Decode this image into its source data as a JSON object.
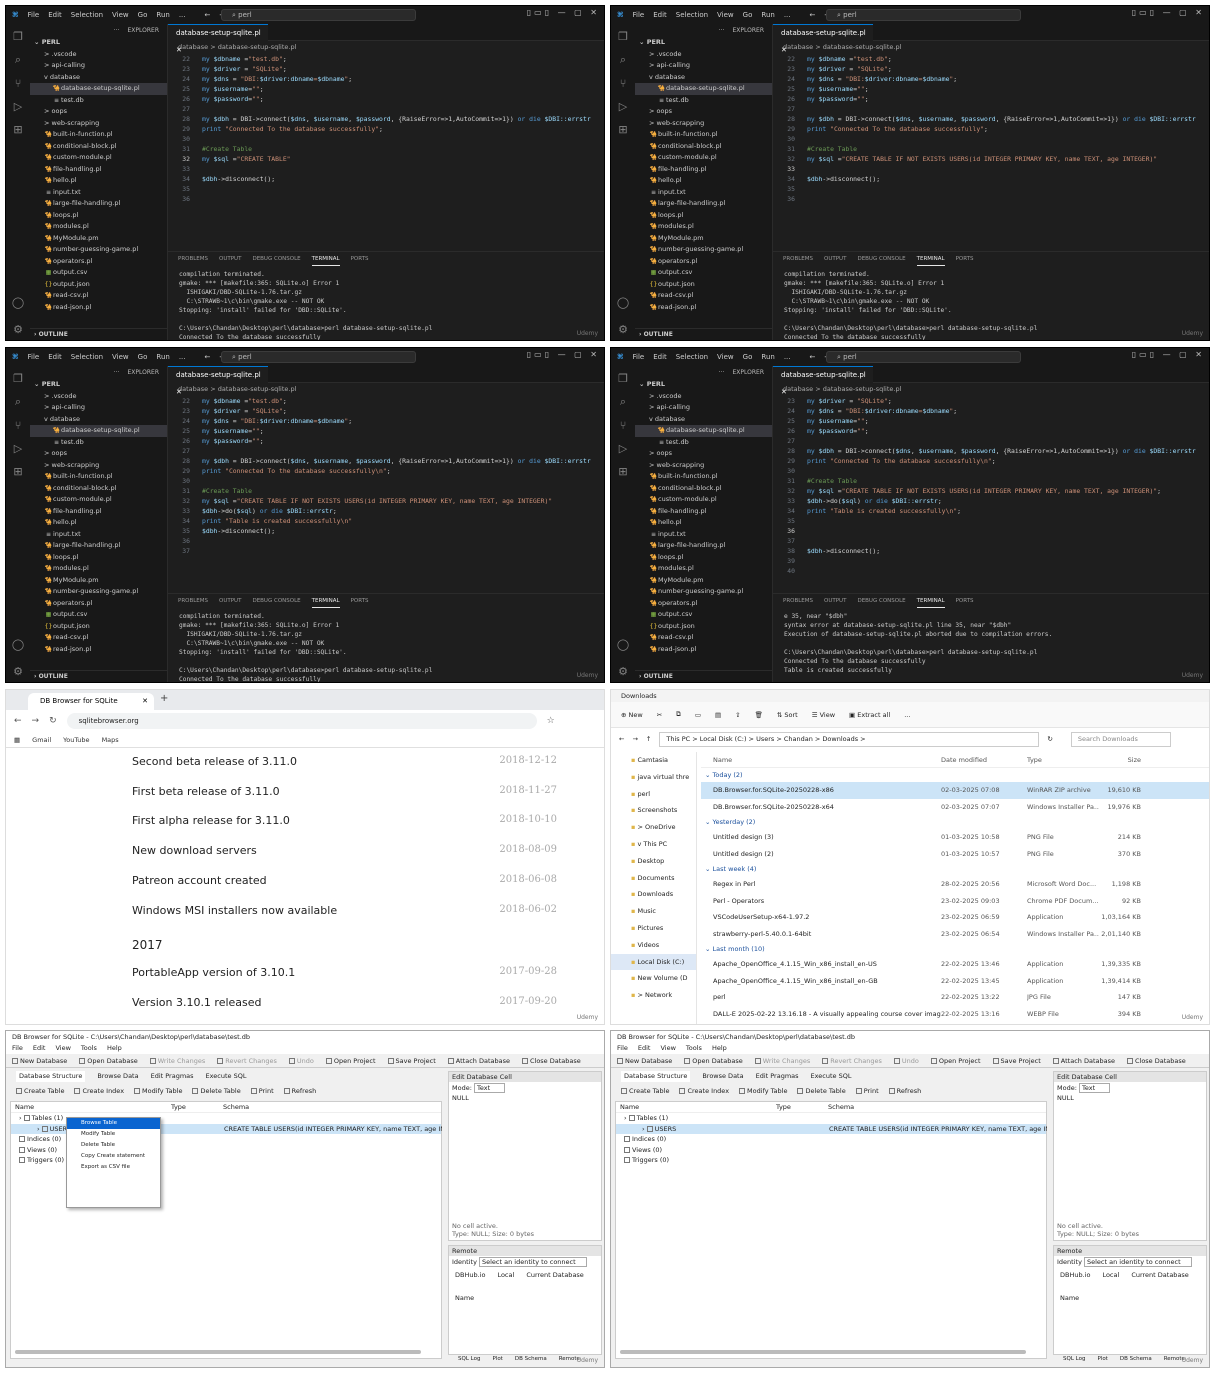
{
  "vscode": {
    "menu": [
      "File",
      "Edit",
      "Selection",
      "View",
      "Go",
      "Run",
      "..."
    ],
    "search": "perl",
    "explorer_title": "EXPLORER",
    "root": "PERL",
    "tab": "database-setup-sqlite.pl",
    "breadcrumb": "database > database-setup-sqlite.pl",
    "term_tabs": [
      "PROBLEMS",
      "OUTPUT",
      "DEBUG CONSOLE",
      "TERMINAL",
      "PORTS"
    ],
    "outline": "OUTLINE",
    "files_a": [
      "> .vscode",
      "> api-calling",
      "v database",
      "database-setup-sqlite.pl",
      "test.db",
      "> oops",
      "> web-scrapping",
      "built-in-function.pl",
      "conditional-block.pl",
      "custom-module.pl",
      "file-handling.pl",
      "hello.pl",
      "input.txt",
      "large-file-handling.pl",
      "loops.pl",
      "modules.pl",
      "MyModule.pm",
      "number-guessing-game.pl",
      "operators.pl",
      "output.csv",
      "output.json",
      "read-csv.pl",
      "read-json.pl"
    ],
    "files_b": [
      "> .vscode",
      "> api-calling",
      "v database",
      "database-setup-sqlite.pl",
      "test.db",
      "> oops",
      "> web-scrapping",
      "built-in-function.pl",
      "conditional-block.pl",
      "custom-module.pl",
      "file-handling.pl",
      "hello.pl",
      "input.txt",
      "large-file-handling.pl",
      "loops.pl",
      "modules.pl",
      "MyModule.pm",
      "number-guessing-game.pl",
      "operators.pl",
      "output.csv",
      "output.json",
      "read-csv.pl",
      "read-json.pl"
    ],
    "files_c": [
      "> .vscode",
      "> api-calling",
      "v database",
      "database-setup-sqlite.pl",
      "test.db",
      "> oops",
      "> web-scrapping",
      "built-in-function.pl",
      "conditional-block.pl",
      "custom-module.pl",
      "file-handling.pl",
      "hello.pl",
      "input.txt",
      "large-file-handling.pl",
      "loops.pl",
      "modules.pl",
      "MyModule.pm",
      "number-guessing-game.pl",
      "operators.pl",
      "output.csv",
      "output.json",
      "read-csv.pl",
      "read-json.pl"
    ],
    "files_d": [
      "> .vscode",
      "> api-calling",
      "v database",
      "database-setup-sqlite.pl",
      "test.db",
      "> oops",
      "> web-scrapping",
      "built-in-function.pl",
      "conditional-block.pl",
      "custom-module.pl",
      "file-handling.pl",
      "hello.pl",
      "input.txt",
      "large-file-handling.pl",
      "loops.pl",
      "modules.pl",
      "MyModule.pm",
      "number-guessing-game.pl",
      "operators.pl",
      "output.csv",
      "output.json",
      "read-csv.pl",
      "read-json.pl"
    ],
    "code_a": [
      [
        "22",
        "my $dbname =\"test.db\";"
      ],
      [
        "23",
        "my $driver = \"SQLite\";"
      ],
      [
        "24",
        "my $dns = \"DBI:$driver:dbname=$dbname\";"
      ],
      [
        "25",
        "my $username=\"\";"
      ],
      [
        "26",
        "my $password=\"\";"
      ],
      [
        "27",
        ""
      ],
      [
        "28",
        "my $dbh = DBI->connect($dns, $username, $password, {RaiseError=>1,AutoCommit=>1}) or die $DBI::errstr"
      ],
      [
        "29",
        "print \"Connected To the database successfully\";"
      ],
      [
        "30",
        ""
      ],
      [
        "31",
        "#Create Table"
      ],
      [
        "32",
        "my $sql =\"CREATE TABLE\""
      ],
      [
        "33",
        ""
      ],
      [
        "34",
        "$dbh->disconnect();"
      ],
      [
        "35",
        ""
      ],
      [
        "36",
        ""
      ]
    ],
    "code_b": [
      [
        "22",
        "my $dbname =\"test.db\";"
      ],
      [
        "23",
        "my $driver = \"SQLite\";"
      ],
      [
        "24",
        "my $dns = \"DBI:$driver:dbname=$dbname\";"
      ],
      [
        "25",
        "my $username=\"\";"
      ],
      [
        "26",
        "my $password=\"\";"
      ],
      [
        "27",
        ""
      ],
      [
        "28",
        "my $dbh = DBI->connect($dns, $username, $password, {RaiseError=>1,AutoCommit=>1}) or die $DBI::errstr"
      ],
      [
        "29",
        "print \"Connected To the database successfully\";"
      ],
      [
        "30",
        ""
      ],
      [
        "31",
        "#Create Table"
      ],
      [
        "32",
        "my $sql =\"CREATE TABLE IF NOT EXISTS USERS(id INTEGER PRIMARY KEY, name TEXT, age INTEGER)\""
      ],
      [
        "33",
        ""
      ],
      [
        "34",
        "$dbh->disconnect();"
      ],
      [
        "35",
        ""
      ],
      [
        "36",
        ""
      ]
    ],
    "code_c": [
      [
        "22",
        "my $dbname =\"test.db\";"
      ],
      [
        "23",
        "my $driver = \"SQLite\";"
      ],
      [
        "24",
        "my $dns = \"DBI:$driver:dbname=$dbname\";"
      ],
      [
        "25",
        "my $username=\"\";"
      ],
      [
        "26",
        "my $password=\"\";"
      ],
      [
        "27",
        ""
      ],
      [
        "28",
        "my $dbh = DBI->connect($dns, $username, $password, {RaiseError=>1,AutoCommit=>1}) or die $DBI::errstr"
      ],
      [
        "29",
        "print \"Connected To the database successfully\\n\";"
      ],
      [
        "30",
        ""
      ],
      [
        "31",
        "#Create Table"
      ],
      [
        "32",
        "my $sql =\"CREATE TABLE IF NOT EXISTS USERS(id INTEGER PRIMARY KEY, name TEXT, age INTEGER)\""
      ],
      [
        "33",
        "$dbh->do($sql) or die $DBI::errstr;"
      ],
      [
        "34",
        "print \"Table is created successfully\\n\""
      ],
      [
        "35",
        "$dbh->disconnect();"
      ],
      [
        "36",
        ""
      ],
      [
        "37",
        ""
      ]
    ],
    "code_d": [
      [
        "23",
        "my $driver = \"SQLite\";"
      ],
      [
        "24",
        "my $dns = \"DBI:$driver:dbname=$dbname\";"
      ],
      [
        "25",
        "my $username=\"\";"
      ],
      [
        "26",
        "my $password=\"\";"
      ],
      [
        "27",
        ""
      ],
      [
        "28",
        "my $dbh = DBI->connect($dns, $username, $password, {RaiseError=>1,AutoCommit=>1}) or die $DBI::errstr"
      ],
      [
        "29",
        "print \"Connected To the database successfully\\n\";"
      ],
      [
        "30",
        ""
      ],
      [
        "31",
        "#Create Table"
      ],
      [
        "32",
        "my $sql =\"CREATE TABLE IF NOT EXISTS USERS(id INTEGER PRIMARY KEY, name TEXT, age INTEGER)\";"
      ],
      [
        "33",
        "$dbh->do($sql) or die $DBI::errstr;"
      ],
      [
        "34",
        "print \"Table is created successfully\\n\";"
      ],
      [
        "35",
        ""
      ],
      [
        "36",
        ""
      ],
      [
        "37",
        ""
      ],
      [
        "38",
        "$dbh->disconnect();"
      ],
      [
        "39",
        ""
      ],
      [
        "40",
        ""
      ]
    ],
    "term_a": [
      "compilation terminated.",
      "gmake: *** [makefile:365: SQLite.o] Error 1",
      "  ISHIGAKI/DBD-SQLite-1.76.tar.gz",
      "  C:\\STRAWB~1\\c\\bin\\gmake.exe -- NOT OK",
      "Stopping: 'install' failed for 'DBD::SQLite'.",
      "",
      "C:\\Users\\Chandan\\Desktop\\perl\\database>perl database-setup-sqlite.pl",
      "Connected To the database successfully"
    ],
    "term_d": [
      "e 35, near \"$dbh\"",
      "syntax error at database-setup-sqlite.pl line 35, near \"$dbh\"",
      "Execution of database-setup-sqlite.pl aborted due to compilation errors.",
      "",
      "C:\\Users\\Chandan\\Desktop\\perl\\database>perl database-setup-sqlite.pl",
      "Connected To the database successfully",
      "Table is created successfully"
    ],
    "watermark": "Udemy"
  },
  "browser": {
    "tab_title": "DB Browser for SQLite",
    "url": "sqlitebrowser.org",
    "bookmarks": [
      "Gmail",
      "YouTube",
      "Maps"
    ],
    "releases": [
      {
        "title": "Second beta release of 3.11.0",
        "date": "2018-12-12"
      },
      {
        "title": "First beta release of 3.11.0",
        "date": "2018-11-27"
      },
      {
        "title": "First alpha release for 3.11.0",
        "date": "2018-10-10"
      },
      {
        "title": "New download servers",
        "date": "2018-08-09"
      },
      {
        "title": "Patreon account created",
        "date": "2018-06-08"
      },
      {
        "title": "Windows MSI installers now available",
        "date": "2018-06-02"
      }
    ],
    "year": "2017",
    "releases2": [
      {
        "title": "PortableApp version of 3.10.1",
        "date": "2017-09-28"
      },
      {
        "title": "Version 3.10.1 released",
        "date": "2017-09-20"
      }
    ]
  },
  "explorer": {
    "title": "Downloads",
    "cmds": [
      "New",
      "Sort",
      "View",
      "Extract all",
      "..."
    ],
    "path": "This PC > Local Disk (C:) > Users > Chandan > Downloads >",
    "search": "Search Downloads",
    "nav": [
      "Camtasia",
      "java virtual thre",
      "perl",
      "Screenshots",
      "> OneDrive",
      "v This PC",
      "Desktop",
      "Documents",
      "Downloads",
      "Music",
      "Pictures",
      "Videos",
      "Local Disk (C:)",
      "New Volume (D",
      "> Network"
    ],
    "cols": [
      "Name",
      "Date modified",
      "Type",
      "Size"
    ],
    "groups": [
      {
        "name": "Today (2)",
        "files": [
          [
            "DB.Browser.for.SQLite-20250228-x86",
            "02-03-2025 07:08",
            "WinRAR ZIP archive",
            "19,610 KB"
          ],
          [
            "DB.Browser.for.SQLite-20250228-x64",
            "02-03-2025 07:07",
            "Windows Installer Pa...",
            "19,976 KB"
          ]
        ]
      },
      {
        "name": "Yesterday (2)",
        "files": [
          [
            "Untitled design (3)",
            "01-03-2025 10:58",
            "PNG File",
            "214 KB"
          ],
          [
            "Untitled design (2)",
            "01-03-2025 10:57",
            "PNG File",
            "370 KB"
          ]
        ]
      },
      {
        "name": "Last week (4)",
        "files": [
          [
            "Regex in Perl",
            "28-02-2025 20:56",
            "Microsoft Word Doc...",
            "1,198 KB"
          ],
          [
            "Perl - Operators",
            "23-02-2025 09:03",
            "Chrome PDF Docum...",
            "92 KB"
          ],
          [
            "VSCodeUserSetup-x64-1.97.2",
            "23-02-2025 06:59",
            "Application",
            "1,03,164 KB"
          ],
          [
            "strawberry-perl-5.40.0.1-64bit",
            "23-02-2025 06:54",
            "Windows Installer Pa...",
            "2,01,140 KB"
          ]
        ]
      },
      {
        "name": "Last month (10)",
        "files": [
          [
            "Apache_OpenOffice_4.1.15_Win_x86_install_en-US",
            "22-02-2025 13:46",
            "Application",
            "1,39,335 KB"
          ],
          [
            "Apache_OpenOffice_4.1.15_Win_x86_install_en-GB",
            "22-02-2025 13:45",
            "Application",
            "1,39,414 KB"
          ],
          [
            "perl",
            "22-02-2025 13:22",
            "JPG File",
            "147 KB"
          ],
          [
            "DALL-E 2025-02-22 13.16.18 - A visually appealing course cover image for 'Ma...",
            "22-02-2025 13:16",
            "WEBP File",
            "394 KB"
          ]
        ]
      }
    ]
  },
  "dbb": {
    "title": "DB Browser for SQLite - C:\\Users\\Chandan\\Desktop\\perl\\database\\test.db",
    "menu": [
      "File",
      "Edit",
      "View",
      "Tools",
      "Help"
    ],
    "tools": [
      "New Database",
      "Open Database",
      "Write Changes",
      "Revert Changes",
      "Undo",
      "Open Project",
      "Save Project",
      "Attach Database",
      "Close Database"
    ],
    "tabs": [
      "Database Structure",
      "Browse Data",
      "Edit Pragmas",
      "Execute SQL"
    ],
    "subtools": [
      "Create Table",
      "Create Index",
      "Modify Table",
      "Delete Table",
      "Print",
      "Refresh"
    ],
    "cols": [
      "Name",
      "Type",
      "Schema"
    ],
    "tree": [
      "Tables (1)",
      "USERS",
      "Indices (0)",
      "Views (0)",
      "Triggers (0)"
    ],
    "schema": "CREATE TABLE USERS(id INTEGER PRIMARY KEY, name TEXT, age INTEGER)",
    "edit_cell": "Edit Database Cell",
    "mode": "Mode:",
    "mode_val": "Text",
    "null": "NULL",
    "cell_info1": "No cell active.",
    "cell_info2": "Type: NULL; Size: 0 bytes",
    "remote": "Remote",
    "identity": "Identity",
    "identity_val": "Select an identity to connect",
    "remote_tabs": [
      "DBHub.io",
      "Local",
      "Current Database"
    ],
    "name_col": "Name",
    "bottom_tabs": [
      "SQL Log",
      "Plot",
      "DB Schema",
      "Remote"
    ],
    "ctx": [
      "Browse Table",
      "Modify Table",
      "Delete Table",
      "Copy Create statement",
      "Export as CSV file"
    ]
  }
}
